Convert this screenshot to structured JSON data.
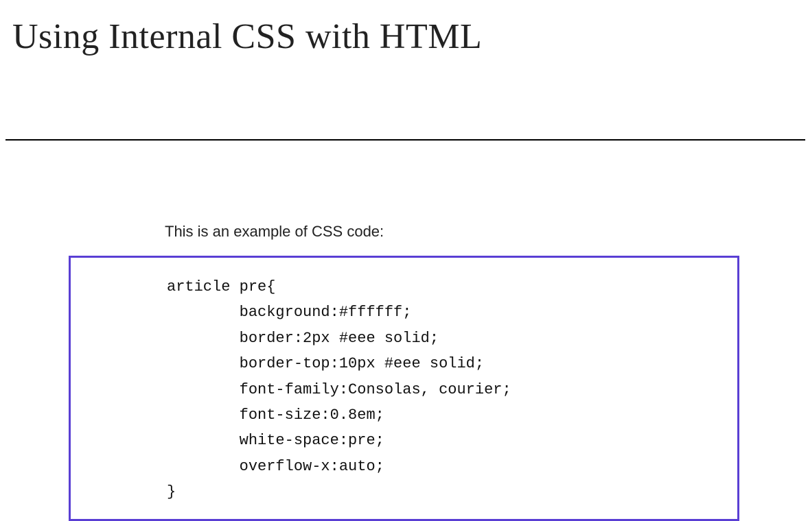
{
  "title": "Using Internal CSS with HTML",
  "intro": "This is an example of CSS code:",
  "code": "article pre{\n        background:#ffffff;\n        border:2px #eee solid;\n        border-top:10px #eee solid;\n        font-family:Consolas, courier;\n        font-size:0.8em;\n        white-space:pre;\n        overflow-x:auto;\n}"
}
